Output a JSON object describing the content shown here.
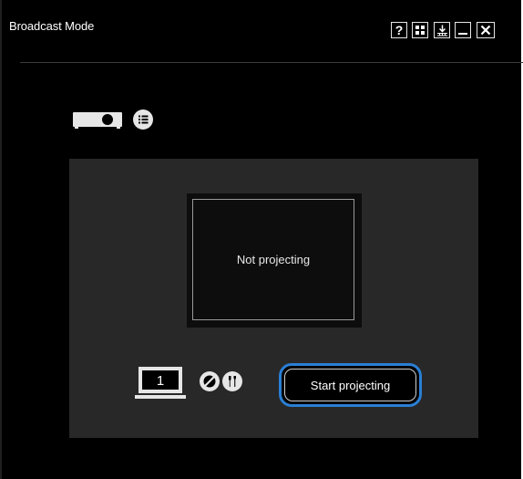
{
  "window": {
    "title": "Broadcast Mode",
    "buttons": {
      "help_label": "?"
    }
  },
  "device": {
    "projector_icon": "projector-icon",
    "menu_icon": "list-menu-icon"
  },
  "preview": {
    "status": "Not projecting"
  },
  "controls": {
    "display_number": "1",
    "start_label": "Start projecting",
    "accent_color": "#2a7fd4"
  },
  "colors": {
    "background": "#000000",
    "panel": "#282828",
    "text": "#ffffff"
  }
}
